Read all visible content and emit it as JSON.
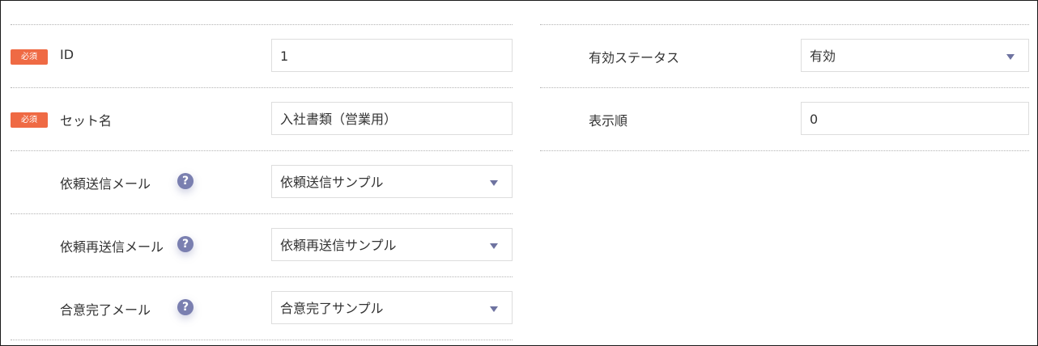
{
  "required_badge": "必須",
  "left": {
    "id": {
      "label": "ID",
      "value": "1"
    },
    "set_name": {
      "label": "セット名",
      "value": "入社書類（営業用）"
    },
    "request_mail": {
      "label": "依頼送信メール",
      "value": "依頼送信サンプル",
      "help": "?"
    },
    "resend_mail": {
      "label": "依頼再送信メール",
      "value": "依頼再送信サンプル",
      "help": "?"
    },
    "complete_mail": {
      "label": "合意完了メール",
      "value": "合意完了サンプル",
      "help": "?"
    }
  },
  "right": {
    "status": {
      "label": "有効ステータス",
      "value": "有効"
    },
    "order": {
      "label": "表示順",
      "value": "0"
    }
  },
  "colors": {
    "badge": "#ef6a44",
    "help_icon": "#7a7fb0",
    "arrow": "#6e73a0"
  }
}
